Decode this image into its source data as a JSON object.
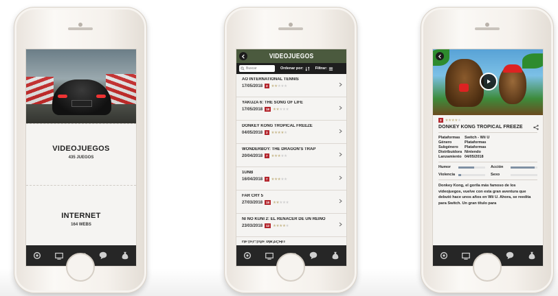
{
  "screen1": {
    "sections": [
      {
        "title": "VIDEOJUEGOS",
        "subtitle": "435 JUEGOS"
      },
      {
        "title": "INTERNET",
        "subtitle": "164 WEBS"
      }
    ]
  },
  "screen2": {
    "title": "VIDEOJUEGOS",
    "search_placeholder": "Buscar",
    "sort_label": "Ordenar por:",
    "filter_label": "Filtrar:",
    "games": [
      {
        "name": "AO INTERNATIONAL TENNIS",
        "date": "17/05/2018",
        "pegi": "3",
        "rating": 2
      },
      {
        "name": "YAKUZA 6: THE SONG OF LIFE",
        "date": "17/05/2018",
        "pegi": "18",
        "rating": 2
      },
      {
        "name": "DONKEY KONG TROPICAL FREEZE",
        "date": "04/05/2018",
        "pegi": "3",
        "rating": 4
      },
      {
        "name": "WONDERBOY: THE DRAGON'S TRAP",
        "date": "20/04/2018",
        "pegi": "7",
        "rating": 3
      },
      {
        "name": "1UNB",
        "date": "16/04/2018",
        "pegi": "7",
        "rating": 3
      },
      {
        "name": "FAR CRY 5",
        "date": "27/03/2018",
        "pegi": "18",
        "rating": 2
      },
      {
        "name": "NI NO KUNI 2: EL RENACER DE UN REINO",
        "date": "23/03/2018",
        "pegi": "12",
        "rating": 4
      },
      {
        "name": "DETECTIVE PIKACHU",
        "date": "",
        "pegi": "",
        "rating": 0
      }
    ]
  },
  "screen3": {
    "pegi": "3",
    "rating": 4,
    "title": "DONKEY KONG TROPICAL FREEZE",
    "specs": [
      {
        "k": "Plataformas",
        "v": "Switch - Wii U"
      },
      {
        "k": "Género",
        "v": "Plataformas"
      },
      {
        "k": "Subgénero",
        "v": "Plataformas"
      },
      {
        "k": "Distribuidora",
        "v": "Nintendo"
      },
      {
        "k": "Lanzamiento",
        "v": "04/05/2018"
      }
    ],
    "levels": [
      {
        "name": "Humor",
        "value": 0.6
      },
      {
        "name": "Acción",
        "value": 0.9
      },
      {
        "name": "Violencia",
        "value": 0.1
      },
      {
        "name": "Sexo",
        "value": 0.0
      }
    ],
    "description": "Donkey Kong, el gorila más famoso de los videojuegos, vuelve con esta gran aventura que debutó hace unos años en Wii U. Ahora, se reedita para Switch. Un gran título para"
  },
  "colors": {
    "header_green": "#4b5a3e",
    "pegi_red": "#b3262d",
    "tabbar": "#262626",
    "level_bar": "#7f90a3"
  }
}
